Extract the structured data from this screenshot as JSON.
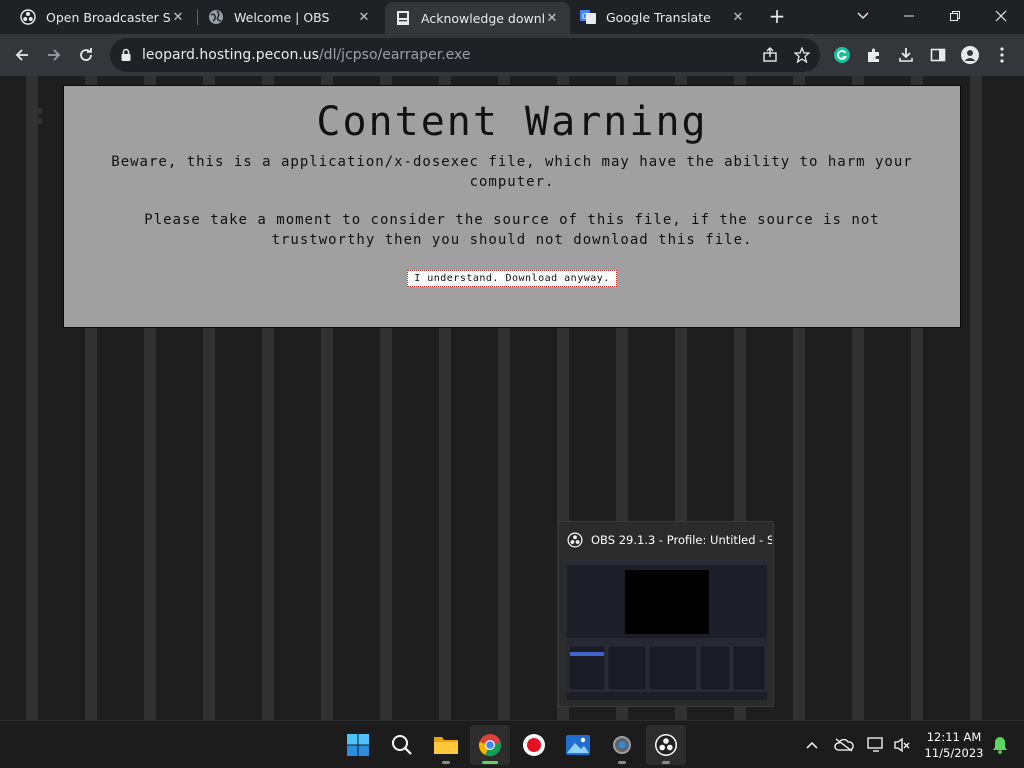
{
  "browser": {
    "tabs": [
      {
        "title": "Open Broadcaster Software",
        "icon": "obs-icon",
        "active": false
      },
      {
        "title": "Welcome | OBS",
        "icon": "globe-icon",
        "active": false
      },
      {
        "title": "Acknowledge download",
        "icon": "document-icon",
        "active": true
      },
      {
        "title": "Google Translate",
        "icon": "google-translate-icon",
        "active": false
      }
    ],
    "url_host": "leopard.hosting.pecon.us",
    "url_path": "/dl/jcpso/earraper.exe"
  },
  "page": {
    "heading": "Content Warning",
    "paragraph1": "Beware, this is a application/x-dosexec file, which may have the ability to harm your computer.",
    "paragraph2": "Please take a moment to consider the source of this file, if the source is not trustworthy then you should not download this file.",
    "download_button": "I understand. Download anyway."
  },
  "obs_preview": {
    "title": "OBS 29.1.3 - Profile: Untitled - S..."
  },
  "taskbar": {
    "apps": [
      "start-icon",
      "search-icon",
      "file-explorer-icon",
      "chrome-icon",
      "record-icon",
      "photos-icon",
      "settings-icon",
      "obs-icon"
    ],
    "time": "12:11 AM",
    "date": "11/5/2023"
  },
  "colors": {
    "warning_box": "#a0a0a0",
    "page_bg": "#1e1e1e",
    "tab_active": "#35363a"
  }
}
